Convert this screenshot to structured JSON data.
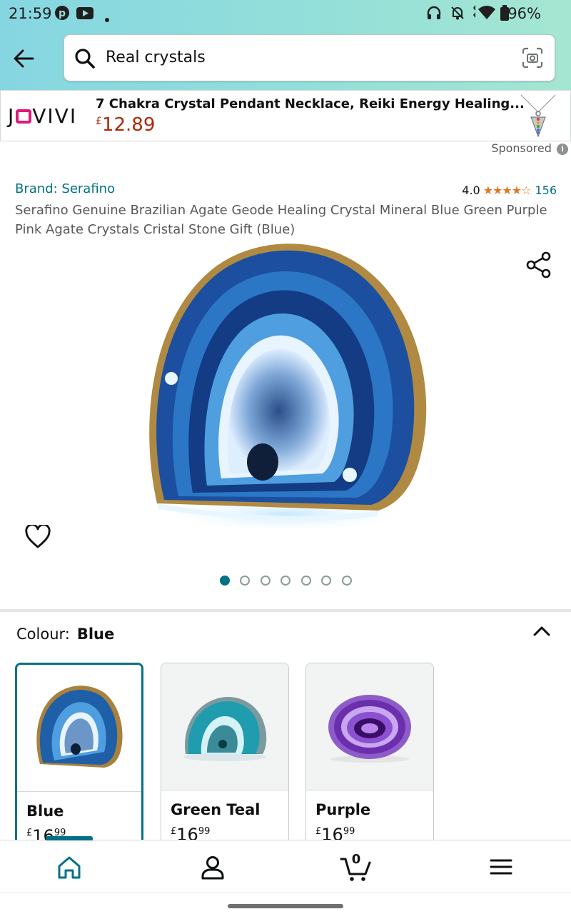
{
  "status_bar": {
    "time": "21:59",
    "left_icons": [
      "pinterest-icon",
      "youtube-icon",
      "notification-dot"
    ],
    "right_icons": [
      "headphones-icon",
      "bell-off-icon",
      "wifi-icon",
      "battery-icon"
    ],
    "battery": "96%"
  },
  "search": {
    "query": "Real crystals",
    "icons": [
      "back-arrow-icon",
      "search-icon",
      "camera-lens-icon"
    ]
  },
  "sponsored_ad": {
    "brand_logo": "JOVIVI",
    "title": "7 Chakra Crystal Pendant Necklace, Reiki Energy Healing...",
    "currency": "£",
    "price": "12.89",
    "sponsored_label": "Sponsored",
    "info_glyph": "i"
  },
  "product": {
    "brand": "Brand: Serafino",
    "rating": "4.0",
    "stars": "★★★★☆",
    "stars_value": 4.0,
    "review_count": "156",
    "title": "Serafino Genuine Brazilian Agate Geode Healing Crystal Mineral Blue Green Purple Pink Agate Crystals Cristal Stone Gift (Blue)",
    "image_count": 7,
    "active_image": 1
  },
  "colour": {
    "label": "Colour:",
    "value": "Blue",
    "options": [
      {
        "name": "Blue",
        "currency": "£",
        "whole": "16",
        "fraction": "99",
        "selected": true,
        "color": "#1f5fa8"
      },
      {
        "name": "Green Teal",
        "currency": "£",
        "whole": "16",
        "fraction": "99",
        "selected": false,
        "color": "#1f9cad"
      },
      {
        "name": "Purple",
        "currency": "£",
        "whole": "16",
        "fraction": "99",
        "selected": false,
        "color": "#7b3fbf"
      }
    ]
  },
  "bottom_nav": {
    "items": [
      "home-icon",
      "account-icon",
      "cart-icon",
      "menu-icon"
    ],
    "cart_count": "0",
    "active": "home"
  },
  "colors": {
    "accent": "#007185",
    "price_red": "#b12704",
    "star_orange": "#de7921",
    "header_gradient": [
      "#86d6e2",
      "#a5e6d2"
    ]
  }
}
